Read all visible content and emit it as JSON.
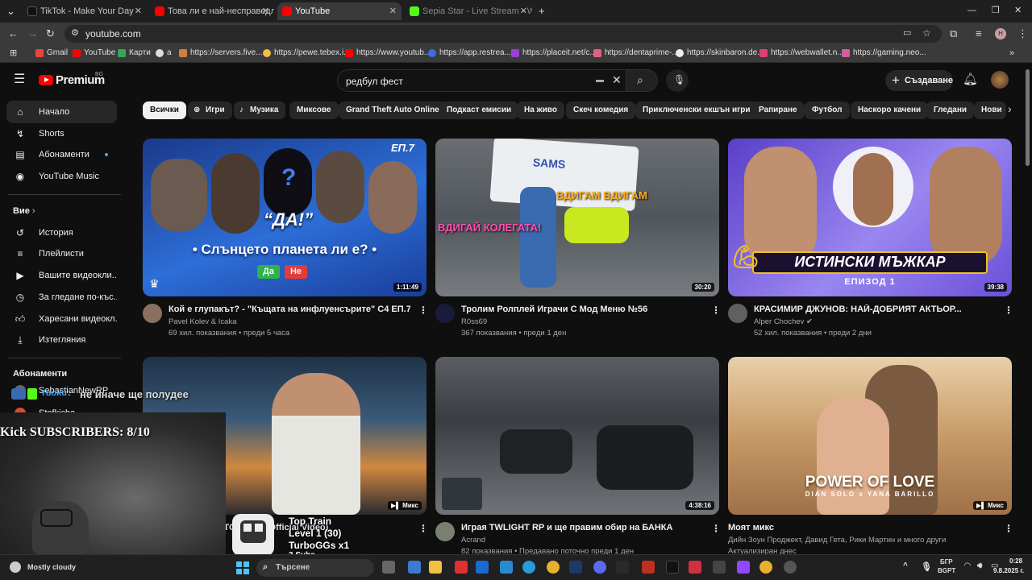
{
  "browser": {
    "tabs": [
      {
        "title": "TikTok - Make Your Day"
      },
      {
        "title": "Това ли е най-несправедливо"
      },
      {
        "title": "YouTube"
      },
      {
        "title": "Sepia Star - Live Stream - Watch"
      }
    ],
    "url": "youtube.com",
    "bookmarks": [
      "Gmail",
      "YouTube",
      "Карти",
      "a",
      "https://servers.five...",
      "https://pewe.tebex.i...",
      "https://www.youtub...",
      "https://app.restrea...",
      "https://placeit.net/c...",
      "https://dentaprime-...",
      "https://skinbaron.de...",
      "https://webwallet.n...",
      "https://gaming.neo..."
    ]
  },
  "header": {
    "logo": "Premium",
    "country": "BG",
    "search_value": "редбул фест",
    "create_label": "Създаване"
  },
  "sidebar": {
    "main": [
      "Начало",
      "Shorts",
      "Абонаменти",
      "YouTube Music"
    ],
    "you_label": "Вие",
    "you_items": [
      "История",
      "Плейлисти",
      "Вашите видеокли...",
      "За гледане по-къс...",
      "Харесани видеокл...",
      "Изтегляния"
    ],
    "subs_label": "Абонаменти",
    "subs": [
      "SebastianNewRP",
      "Stefkicha"
    ]
  },
  "chips": [
    "Всички",
    "Игри",
    "Музика",
    "Миксове",
    "Grand Theft Auto Online",
    "Подкаст емисии",
    "На живо",
    "Скеч комедия",
    "Приключенски екшън игри",
    "Рапиране",
    "Футбол",
    "Наскоро качени",
    "Гледани",
    "Нови"
  ],
  "videos": [
    {
      "title": "Кой е глупакът? - \"Къщата на инфлуенсърите\" С4 ЕП.7",
      "channel": "Pavel Kolev & Icaka",
      "stats": "69 хил. показвания • преди 5 часа",
      "duration": "1:11:49",
      "thumb_text": "• Слънцето планета ли е? •",
      "thumb_tag": "ЕП.7",
      "thumb_quote": "“ДА!”",
      "yes": "Да",
      "no": "Не",
      "colors": [
        "#1b3d8a",
        "#3c7de0"
      ]
    },
    {
      "title": "Тролим Ролплей Играчи С Мод Меню №56",
      "channel": "R0ss69",
      "stats": "367 показвания • преди 1 ден",
      "duration": "30:20",
      "thumb_text": "ВДИГАЙ КОЛЕГАТА!",
      "thumb_text2": "ВДИГАМ ВДИГАМ",
      "thumb_tag": "SAMS",
      "colors": [
        "#5a6068",
        "#8a8e92"
      ]
    },
    {
      "title": "КРАСИМИР ДЖУНОВ: НАЙ-ДОБРИЯТ АКТЬОР...",
      "channel": "Alper Chochev",
      "stats": "52 хил. показвания • преди 2 дни",
      "duration": "39:38",
      "thumb_text": "ИСТИНСКИ МЪЖКАР",
      "thumb_text2": "ЕПИЗОД 1",
      "colors": [
        "#6b4fd0",
        "#a08cf0"
      ]
    },
    {
      "title": "STCO x ST (Official Video)",
      "channel": "",
      "stats": "",
      "duration": "Микс",
      "colors": [
        "#2a4660",
        "#e08840"
      ]
    },
    {
      "title": "Играя TWLIGHT RP и ще правим обир на БАНКА",
      "channel": "Acrand",
      "stats": "82 показвания • Предавано поточно преди 1 ден",
      "duration": "4:38:16",
      "colors": [
        "#3a3d40",
        "#6a6e70"
      ]
    },
    {
      "title": "Моят микс",
      "channel": "Дийн Зоун Проджект, Давид Гета, Рики Мартин и много други",
      "stats": "Актуализиран днес",
      "duration": "Микс",
      "thumb_text": "POWER OF LOVE",
      "thumb_text2": "DIAN SOLO x YANA BARILLO",
      "colors": [
        "#c89a6a",
        "#e8c8a0"
      ]
    }
  ],
  "overlay": {
    "chat": "не иначе ще полудее",
    "chat_user": "Yuoku",
    "subs_counter": "Kick SUBSCRIBERS: 8/10",
    "train_title": "Top Train",
    "train_level": "Level 1 (30)",
    "train_user": "TurboGGs x1",
    "train_subs": "3 Subs"
  },
  "taskbar": {
    "weather": "Mostly cloudy",
    "search_placeholder": "Търсене",
    "lang1": "БГР",
    "lang2": "BGPT",
    "time": "0:28",
    "date": "9.8.2025 г."
  }
}
